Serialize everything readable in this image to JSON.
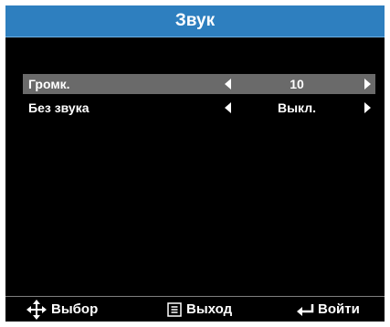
{
  "window": {
    "title": "Звук"
  },
  "menu": {
    "items": [
      {
        "label": "Громк.",
        "value": "10",
        "selected": true
      },
      {
        "label": "Без звука",
        "value": "Выкл.",
        "selected": false
      }
    ]
  },
  "footer": {
    "select_label": "Выбор",
    "exit_label": "Выход",
    "enter_label": "Войти"
  },
  "colors": {
    "title_bar": "#2e7fbf",
    "selected_row": "#6a6a6a",
    "background": "#000000"
  },
  "icons": {
    "select": "four-way-arrows-icon",
    "exit": "menu-icon",
    "enter": "enter-arrow-icon"
  }
}
